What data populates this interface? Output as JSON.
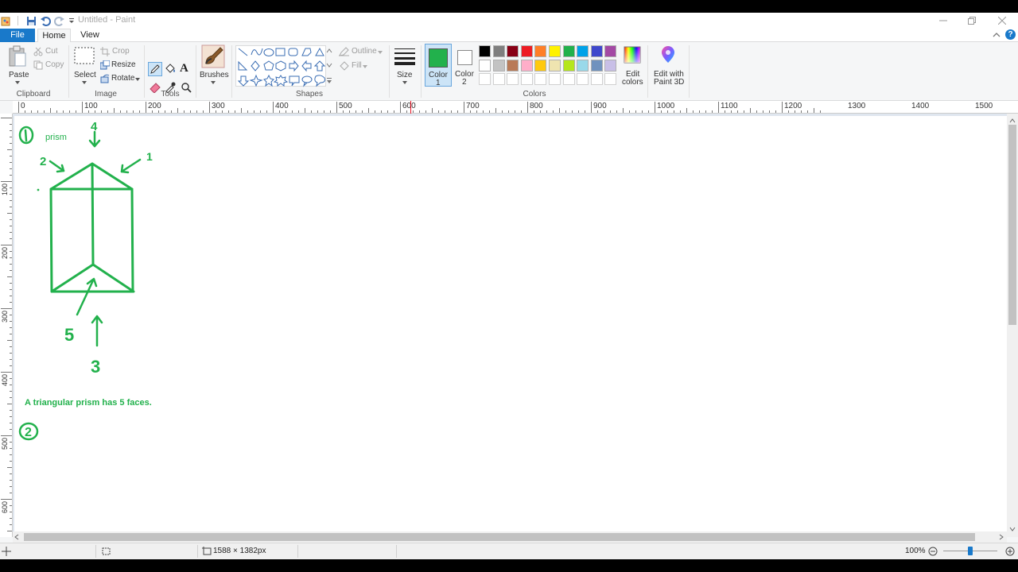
{
  "window": {
    "title": "Untitled - Paint"
  },
  "tabs": [
    "File",
    "Home",
    "View"
  ],
  "clipboard": {
    "paste": "Paste",
    "cut": "Cut",
    "copy": "Copy",
    "label": "Clipboard"
  },
  "image": {
    "select": "Select",
    "crop": "Crop",
    "resize": "Resize",
    "rotate": "Rotate",
    "label": "Image"
  },
  "tools": {
    "label": "Tools",
    "text_tool": "A"
  },
  "brushes": {
    "label": "Brushes"
  },
  "shapes": {
    "label": "Shapes",
    "outline": "Outline",
    "fill": "Fill"
  },
  "size": {
    "label": "Size"
  },
  "colors_group": {
    "color1_label": "Color",
    "color1_num": "1",
    "color2_label": "Color",
    "color2_num": "2",
    "edit_colors_1": "Edit",
    "edit_colors_2": "colors",
    "paint3d_1": "Edit with",
    "paint3d_2": "Paint 3D",
    "label": "Colors",
    "color1_value": "#22b14c",
    "color2_value": "#ffffff",
    "palette_row1": [
      "#000000",
      "#7f7f7f",
      "#880015",
      "#ed1c24",
      "#ff7f27",
      "#fff200",
      "#22b14c",
      "#00a2e8",
      "#3f48cc",
      "#a349a4"
    ],
    "palette_row2": [
      "#ffffff",
      "#c3c3c3",
      "#b97a57",
      "#ffaec9",
      "#ffc90e",
      "#efe4b0",
      "#b5e61d",
      "#99d9ea",
      "#7092be",
      "#c8bfe7"
    ],
    "palette_row3": [
      "#ffffff",
      "#ffffff",
      "#ffffff",
      "#ffffff",
      "#ffffff",
      "#ffffff",
      "#ffffff",
      "#ffffff",
      "#ffffff",
      "#ffffff"
    ]
  },
  "ruler": {
    "h_ticks": [
      "0",
      "100",
      "200",
      "300",
      "400",
      "500",
      "600",
      "700",
      "800",
      "900",
      "1000",
      "1100",
      "1200",
      "1300",
      "1400",
      "1500"
    ],
    "v_ticks": [
      "100",
      "200",
      "300",
      "400",
      "500",
      "600"
    ]
  },
  "drawing": {
    "stroke_color": "#22b14c",
    "label_1": "①",
    "word_prism": "prism",
    "num_1": "1",
    "num_2": "2",
    "num_3": "3",
    "num_4": "4",
    "num_5": "5",
    "sentence": "A triangular prism has 5 faces.",
    "label_2": "②"
  },
  "status": {
    "canvas_size": "1588 × 1382px",
    "zoom": "100%"
  }
}
